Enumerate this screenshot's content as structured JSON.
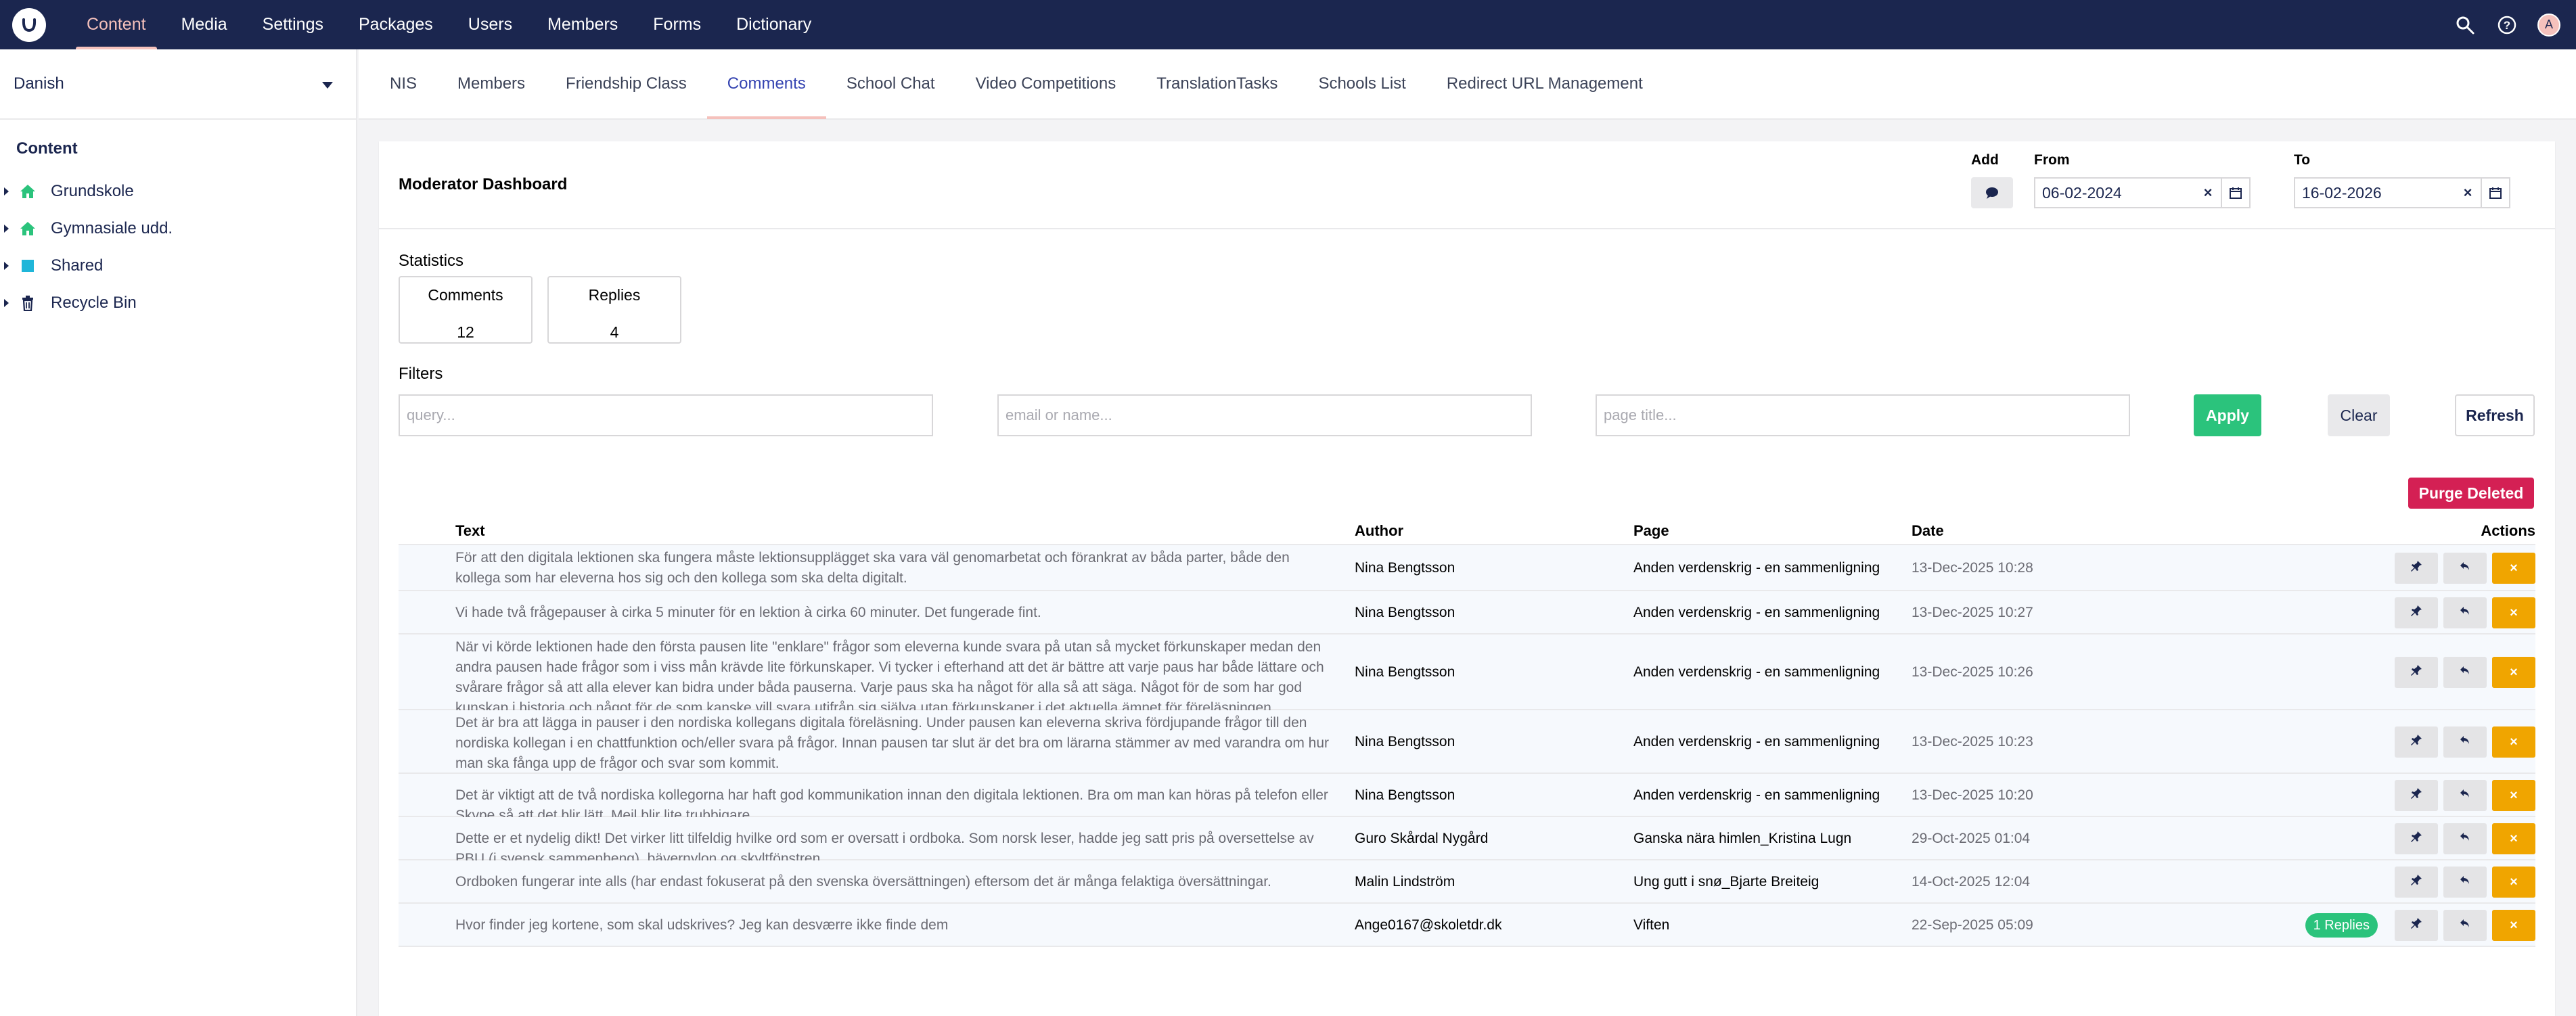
{
  "header": {
    "nav": [
      "Content",
      "Media",
      "Settings",
      "Packages",
      "Users",
      "Members",
      "Forms",
      "Dictionary"
    ],
    "active_nav": "Content",
    "avatar_initial": "A"
  },
  "sidebar": {
    "language": "Danish",
    "tree_title": "Content",
    "items": [
      {
        "label": "Grundskole",
        "icon": "home-icon"
      },
      {
        "label": "Gymnasiale udd.",
        "icon": "home-icon"
      },
      {
        "label": "Shared",
        "icon": "square-icon"
      },
      {
        "label": "Recycle Bin",
        "icon": "trash-icon"
      }
    ]
  },
  "tabs": [
    "NIS",
    "Members",
    "Friendship Class",
    "Comments",
    "School Chat",
    "Video Competitions",
    "TranslationTasks",
    "Schools List",
    "Redirect URL Management"
  ],
  "active_tab": "Comments",
  "dashboard": {
    "title": "Moderator Dashboard",
    "add_label": "Add",
    "from_label": "From",
    "from_value": "06-02-2024",
    "to_label": "To",
    "to_value": "16-02-2026",
    "statistics_label": "Statistics",
    "stats": [
      {
        "label": "Comments",
        "value": "12"
      },
      {
        "label": "Replies",
        "value": "4"
      }
    ],
    "filters_label": "Filters",
    "filters": {
      "query_placeholder": "query...",
      "email_placeholder": "email or name...",
      "page_placeholder": "page title..."
    },
    "buttons": {
      "apply": "Apply",
      "clear": "Clear",
      "refresh": "Refresh",
      "purge": "Purge Deleted"
    },
    "columns": {
      "text": "Text",
      "author": "Author",
      "page": "Page",
      "date": "Date",
      "actions": "Actions"
    },
    "rows": [
      {
        "text": "För att den digitala lektionen ska fungera måste lektionsupplägget ska vara väl genomarbetat och förankrat av båda parter, både den kollega som har eleverna hos sig och den kollega som ska delta digitalt.",
        "author": "Nina Bengtsson",
        "page": "Anden verdenskrig - en sammenligning",
        "date": "13-Dec-2025 10:28",
        "replies": ""
      },
      {
        "text": "Vi hade två frågepauser à cirka 5 minuter för en lektion à cirka 60 minuter. Det fungerade fint.",
        "author": "Nina Bengtsson",
        "page": "Anden verdenskrig - en sammenligning",
        "date": "13-Dec-2025 10:27",
        "replies": ""
      },
      {
        "text": "När vi körde lektionen hade den första pausen lite \"enklare\" frågor som eleverna kunde svara på utan så mycket förkunskaper medan den andra pausen hade frågor som i viss mån krävde lite förkunskaper. Vi tycker i efterhand att det är bättre att varje paus har både lättare och svårare frågor så att alla elever kan bidra under båda pauserna. Varje paus ska ha något för alla så att säga. Något för de som har god kunskap i historia och något för de som kanske vill svara utifrån sig själva utan förkunskaper i det aktuella ämnet för föreläsningen.",
        "author": "Nina Bengtsson",
        "page": "Anden verdenskrig - en sammenligning",
        "date": "13-Dec-2025 10:26",
        "replies": ""
      },
      {
        "text": "Det är bra att lägga in pauser i den nordiska kollegans digitala föreläsning. Under pausen kan eleverna skriva fördjupande frågor till den nordiska kollegan i en chattfunktion och/eller svara på frågor. Innan pausen tar slut är det bra om lärarna stämmer av med varandra om hur man ska fånga upp de frågor och svar som kommit.",
        "author": "Nina Bengtsson",
        "page": "Anden verdenskrig - en sammenligning",
        "date": "13-Dec-2025 10:23",
        "replies": ""
      },
      {
        "text": "Det är viktigt att de två nordiska kollegorna har haft god kommunikation innan den digitala lektionen. Bra om man kan höras på telefon eller Skype så att det blir lätt. Mejl blir lite trubbigare",
        "author": "Nina Bengtsson",
        "page": "Anden verdenskrig - en sammenligning",
        "date": "13-Dec-2025 10:20",
        "replies": ""
      },
      {
        "text": "Dette er et nydelig dikt! Det virker litt tilfeldig hvilke ord som er oversatt i ordboka. Som norsk leser, hadde jeg satt pris på oversettelse av PBU (i svensk sammenheng), bävernylon og skyltfönstren.",
        "author": "Guro Skårdal Nygård",
        "page": "Ganska nära himlen_Kristina Lugn",
        "date": "29-Oct-2025 01:04",
        "replies": ""
      },
      {
        "text": "Ordboken fungerar inte alls (har endast fokuserat på den svenska översättningen) eftersom det är många felaktiga översättningar.",
        "author": "Malin Lindström",
        "page": "Ung gutt i snø_Bjarte Breiteig",
        "date": "14-Oct-2025 12:04",
        "replies": ""
      },
      {
        "text": "Hvor finder jeg kortene, som skal udskrives? Jeg kan desværre ikke finde dem",
        "author": "Ange0167@skoletdr.dk",
        "page": "Viften",
        "date": "22-Sep-2025 05:09",
        "replies": "1 Replies"
      }
    ]
  }
}
